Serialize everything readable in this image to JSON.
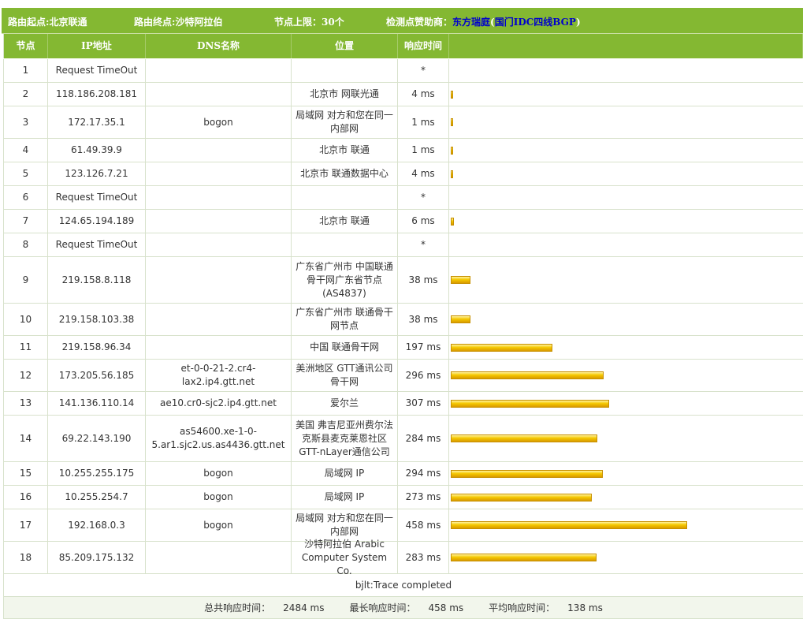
{
  "topbar": {
    "origin_label": "路由起点:",
    "origin_value": "北京联通",
    "dest_label": "路由终点:",
    "dest_value": "沙特阿拉伯",
    "hops_label": "节点上限：",
    "hops_value": "30个",
    "sponsor_label": "检测点赞助商：",
    "sponsor_link": "东方瑞庭",
    "sponsor_paren_open": "(",
    "sponsor_link2": "国门IDC四线BGP",
    "sponsor_paren_close": ")"
  },
  "columns": [
    "节点",
    "IP地址",
    "DNS名称",
    "位置",
    "响应时间",
    ""
  ],
  "colors": {
    "accent": "#84b832",
    "bar": "#f5c800",
    "link": "#0000cc"
  },
  "max_bar_ms": 458,
  "rows": [
    {
      "node": "1",
      "ip": "Request TimeOut",
      "dns": "",
      "location": "",
      "time": "*",
      "ms": 0
    },
    {
      "node": "2",
      "ip": "118.186.208.181",
      "dns": "",
      "location": "北京市 网联光通",
      "time": "4 ms",
      "ms": 4
    },
    {
      "node": "3",
      "ip": "172.17.35.1",
      "dns": "bogon",
      "location": "局域网 对方和您在同一内部网",
      "time": "1 ms",
      "ms": 1
    },
    {
      "node": "4",
      "ip": "61.49.39.9",
      "dns": "",
      "location": "北京市 联通",
      "time": "1 ms",
      "ms": 1
    },
    {
      "node": "5",
      "ip": "123.126.7.21",
      "dns": "",
      "location": "北京市 联通数据中心",
      "time": "4 ms",
      "ms": 4
    },
    {
      "node": "6",
      "ip": "Request TimeOut",
      "dns": "",
      "location": "",
      "time": "*",
      "ms": 0
    },
    {
      "node": "7",
      "ip": "124.65.194.189",
      "dns": "",
      "location": "北京市 联通",
      "time": "6 ms",
      "ms": 6
    },
    {
      "node": "8",
      "ip": "Request TimeOut",
      "dns": "",
      "location": "",
      "time": "*",
      "ms": 0
    },
    {
      "node": "9",
      "ip": "219.158.8.118",
      "dns": "",
      "location": "广东省广州市 中国联通骨干网广东省节点(AS4837)",
      "time": "38 ms",
      "ms": 38
    },
    {
      "node": "10",
      "ip": "219.158.103.38",
      "dns": "",
      "location": "广东省广州市 联通骨干网节点",
      "time": "38 ms",
      "ms": 38
    },
    {
      "node": "11",
      "ip": "219.158.96.34",
      "dns": "",
      "location": "中国 联通骨干网",
      "time": "197 ms",
      "ms": 197
    },
    {
      "node": "12",
      "ip": "173.205.56.185",
      "dns": "et-0-0-21-2.cr4-lax2.ip4.gtt.net",
      "location": "美洲地区 GTT通讯公司骨干网",
      "time": "296 ms",
      "ms": 296
    },
    {
      "node": "13",
      "ip": "141.136.110.14",
      "dns": "ae10.cr0-sjc2.ip4.gtt.net",
      "location": "爱尔兰",
      "time": "307 ms",
      "ms": 307
    },
    {
      "node": "14",
      "ip": "69.22.143.190",
      "dns": "as54600.xe-1-0-5.ar1.sjc2.us.as4436.gtt.net",
      "location": "美国 弗吉尼亚州费尔法克斯县麦克莱恩社区GTT-nLayer通信公司",
      "time": "284 ms",
      "ms": 284
    },
    {
      "node": "15",
      "ip": "10.255.255.175",
      "dns": "bogon",
      "location": "局域网 IP",
      "time": "294 ms",
      "ms": 294
    },
    {
      "node": "16",
      "ip": "10.255.254.7",
      "dns": "bogon",
      "location": "局域网 IP",
      "time": "273 ms",
      "ms": 273
    },
    {
      "node": "17",
      "ip": "192.168.0.3",
      "dns": "bogon",
      "location": "局域网 对方和您在同一内部网",
      "time": "458 ms",
      "ms": 458
    },
    {
      "node": "18",
      "ip": "85.209.175.132",
      "dns": "",
      "location": "沙特阿拉伯 Arabic Computer System Co.",
      "time": "283 ms",
      "ms": 283
    }
  ],
  "footer": {
    "status": "bjlt:Trace completed",
    "total_label": "总共响应时间：",
    "total_value": "2484 ms",
    "max_label": "最长响应时间：",
    "max_value": "458 ms",
    "avg_label": "平均响应时间：",
    "avg_value": "138 ms"
  }
}
